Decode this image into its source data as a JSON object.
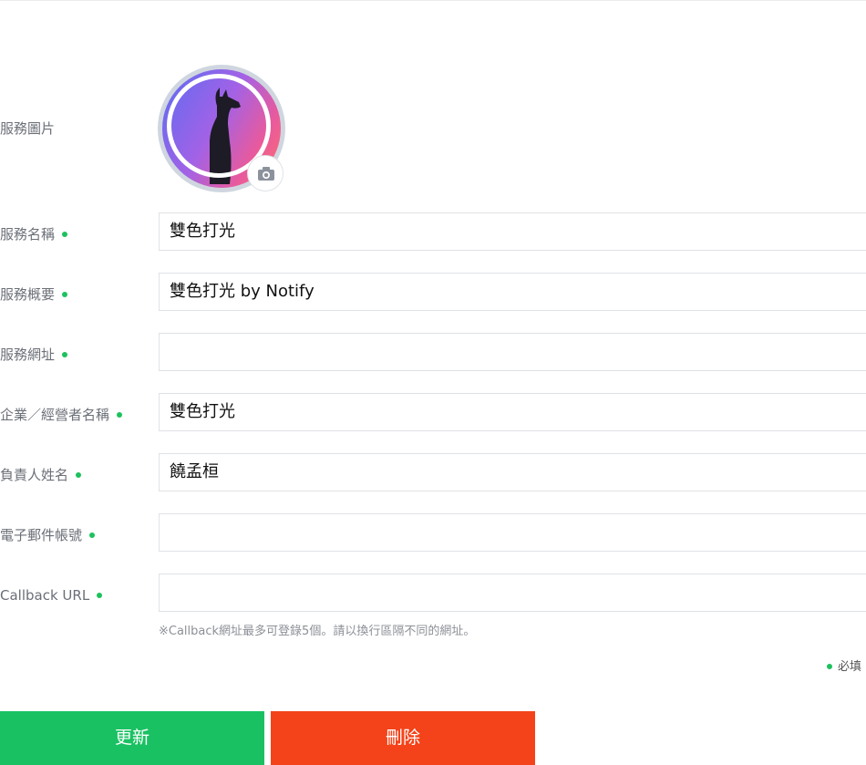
{
  "form": {
    "service_image_label": "服務圖片",
    "fields": [
      {
        "label": "服務名稱",
        "value": "雙色打光",
        "required": true
      },
      {
        "label": "服務概要",
        "value": "雙色打光 by Notify",
        "required": true
      },
      {
        "label": "服務網址",
        "value": "",
        "required": true
      },
      {
        "label": "企業／經營者名稱",
        "value": "雙色打光",
        "required": true
      },
      {
        "label": "負責人姓名",
        "value": "饒孟桓",
        "required": true
      },
      {
        "label": "電子郵件帳號",
        "value": "",
        "required": true
      },
      {
        "label": "Callback URL",
        "value": "",
        "required": true
      }
    ],
    "callback_hint": "※Callback網址最多可登錄5個。請以換行區隔不同的網址。",
    "required_legend": "必填"
  },
  "buttons": {
    "update_label": "更新",
    "delete_label": "刪除"
  },
  "icons": {
    "camera": "camera-icon",
    "avatar": "llama-silhouette"
  },
  "colors": {
    "required_dot": "#1dc15e",
    "update_button": "#1ac162",
    "delete_button": "#f4431a"
  }
}
